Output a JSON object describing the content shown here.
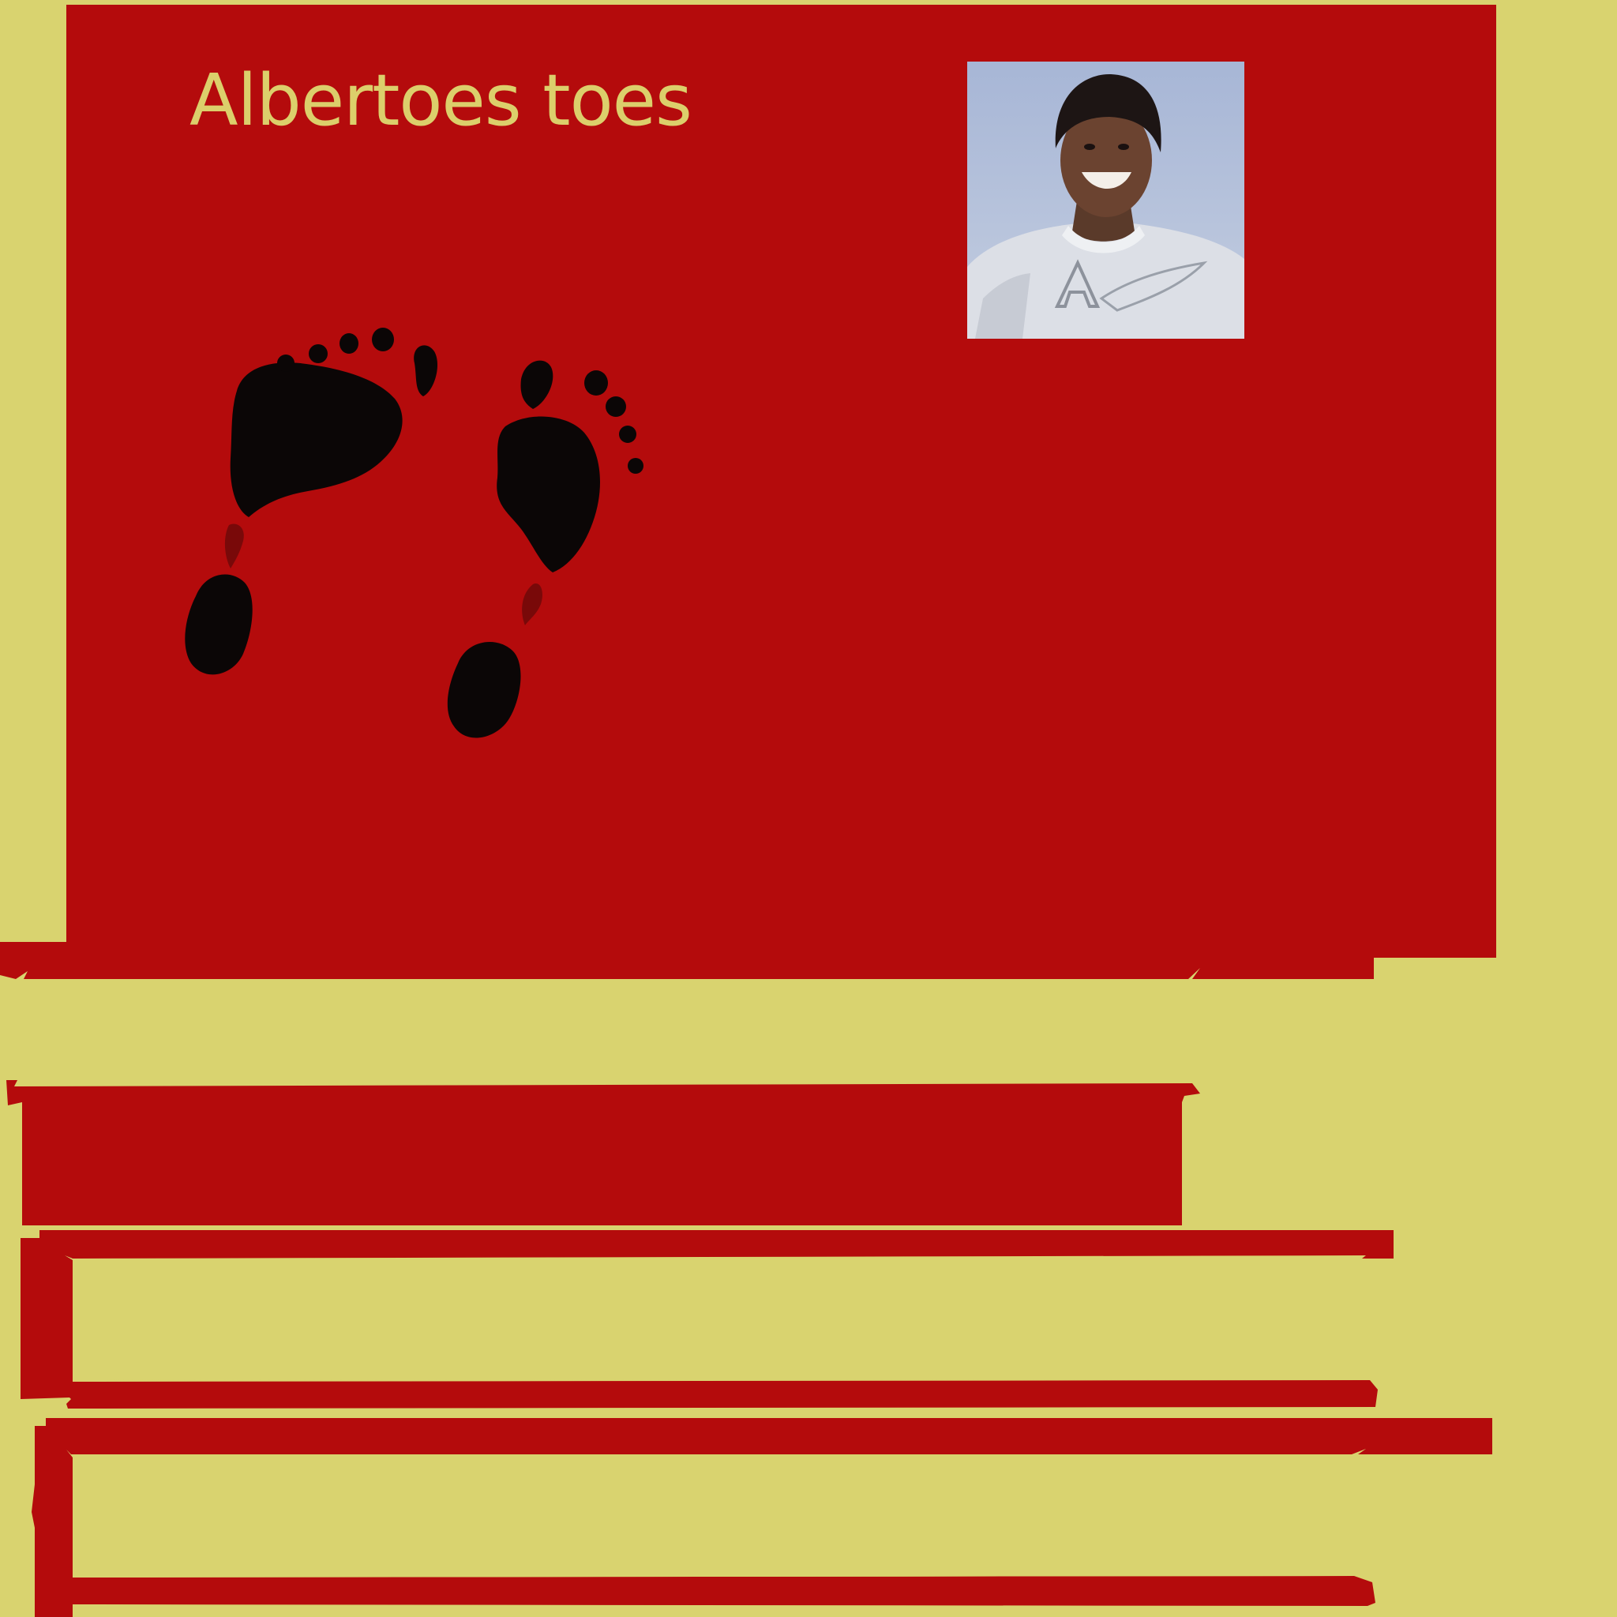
{
  "page": {
    "title": "Albertoes toes"
  },
  "colors": {
    "background": "#d9d36f",
    "panel_red": "#b40b0c",
    "title_text": "#dccf6b",
    "ink": "#0b0606"
  },
  "icons": {
    "avatar": "profile-photo",
    "footprints": "footprints-icon"
  }
}
